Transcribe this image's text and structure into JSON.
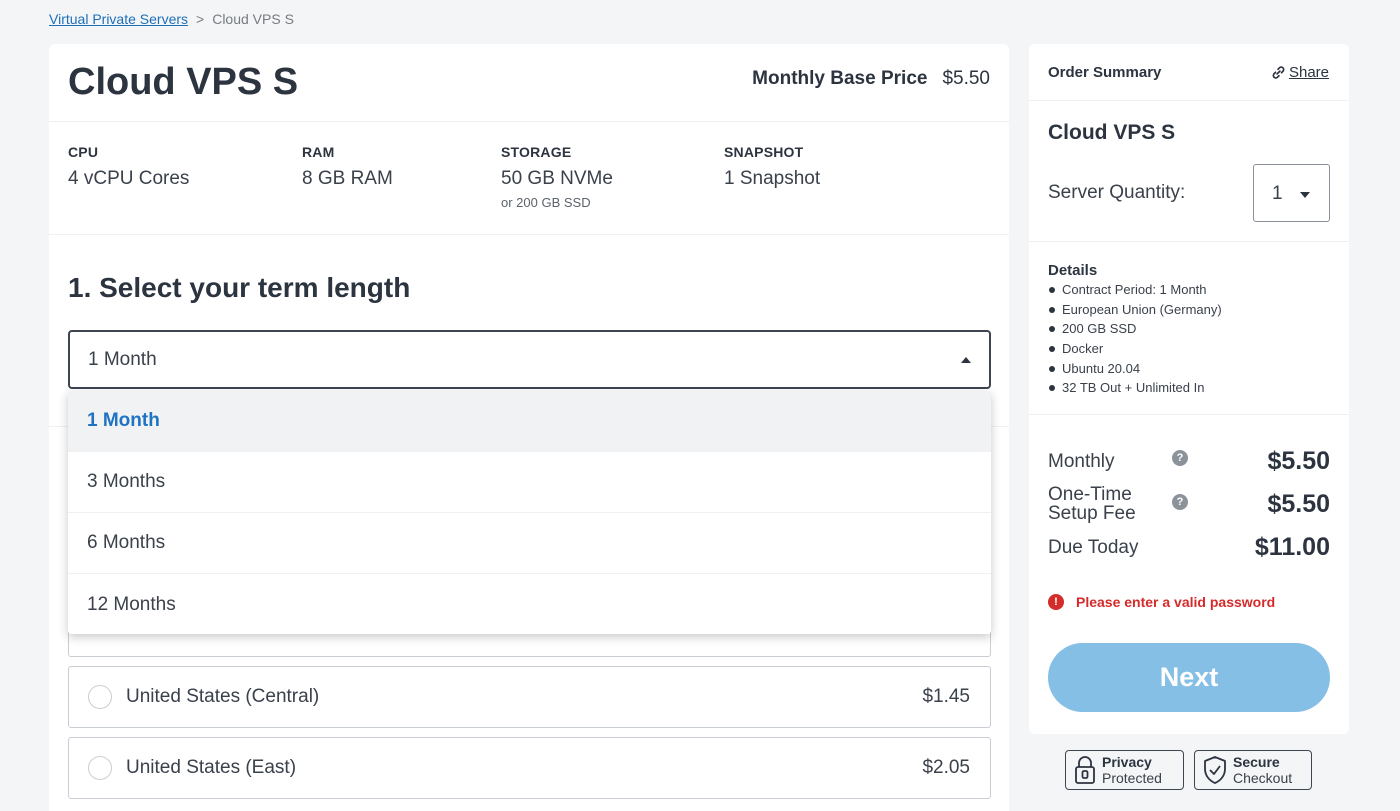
{
  "breadcrumb": {
    "parent": "Virtual Private Servers",
    "separator": ">",
    "current": "Cloud VPS S"
  },
  "product": {
    "title": "Cloud VPS S",
    "base_price_label": "Monthly Base Price",
    "base_price_value": "$5.50",
    "specs": [
      {
        "label": "CPU",
        "value": "4 vCPU Cores",
        "sub": ""
      },
      {
        "label": "RAM",
        "value": "8 GB RAM",
        "sub": ""
      },
      {
        "label": "STORAGE",
        "value": "50 GB NVMe",
        "sub": "or 200 GB SSD"
      },
      {
        "label": "SNAPSHOT",
        "value": "1 Snapshot",
        "sub": ""
      }
    ]
  },
  "term": {
    "title": "1. Select your term length",
    "selected": "1 Month",
    "options": [
      "1 Month",
      "3 Months",
      "6 Months",
      "12 Months"
    ]
  },
  "locations": [
    {
      "name": "United States (Central)",
      "price": "$1.45"
    },
    {
      "name": "United States (East)",
      "price": "$2.05"
    }
  ],
  "summary": {
    "title": "Order Summary",
    "share_label": "Share",
    "product_name": "Cloud VPS S",
    "quantity_label": "Server Quantity:",
    "quantity_value": "1",
    "details_title": "Details",
    "details": [
      "Contract Period: 1 Month",
      "European Union (Germany)",
      "200 GB SSD",
      "Docker",
      "Ubuntu 20.04",
      "32 TB Out + Unlimited In"
    ],
    "monthly_label": "Monthly",
    "monthly_value": "$5.50",
    "setup_label_line1": "One-Time",
    "setup_label_line2": "Setup Fee",
    "setup_value": "$5.50",
    "due_label": "Due Today",
    "due_value": "$11.00",
    "help_glyph": "?",
    "error_glyph": "!",
    "error_text": "Please enter a valid password",
    "next_label": "Next"
  },
  "badges": {
    "privacy_line1": "Privacy",
    "privacy_line2": "Protected",
    "secure_line1": "Secure",
    "secure_line2": "Checkout"
  },
  "colors": {
    "accent": "#1e73c2",
    "next_button": "#86bfe5",
    "error": "#d42b2b"
  }
}
